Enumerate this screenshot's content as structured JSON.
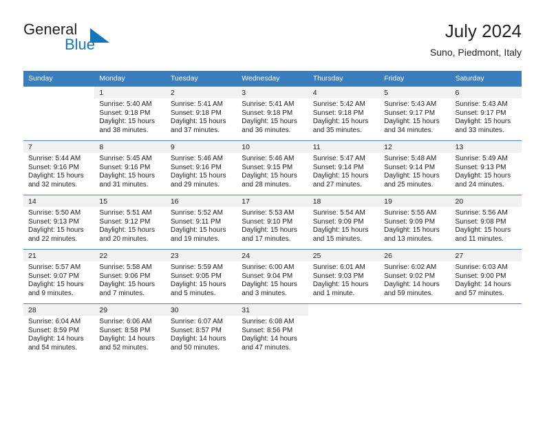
{
  "brand": {
    "name_part1": "General",
    "name_part2": "Blue",
    "triangle_color": "#1175c0"
  },
  "header": {
    "title": "July 2024",
    "subtitle": "Suno, Piedmont, Italy"
  },
  "theme": {
    "header_bg": "#3a7ebf",
    "daynum_band_bg": "#f1f1f1",
    "row_border": "#4a86c5",
    "text": "#1a1a1a"
  },
  "weekdays": [
    "Sunday",
    "Monday",
    "Tuesday",
    "Wednesday",
    "Thursday",
    "Friday",
    "Saturday"
  ],
  "weeks": [
    [
      {
        "day": "",
        "sunrise": "",
        "sunset": "",
        "daylight1": "",
        "daylight2": "",
        "blank": true
      },
      {
        "day": "1",
        "sunrise": "Sunrise: 5:40 AM",
        "sunset": "Sunset: 9:18 PM",
        "daylight1": "Daylight: 15 hours",
        "daylight2": "and 38 minutes."
      },
      {
        "day": "2",
        "sunrise": "Sunrise: 5:41 AM",
        "sunset": "Sunset: 9:18 PM",
        "daylight1": "Daylight: 15 hours",
        "daylight2": "and 37 minutes."
      },
      {
        "day": "3",
        "sunrise": "Sunrise: 5:41 AM",
        "sunset": "Sunset: 9:18 PM",
        "daylight1": "Daylight: 15 hours",
        "daylight2": "and 36 minutes."
      },
      {
        "day": "4",
        "sunrise": "Sunrise: 5:42 AM",
        "sunset": "Sunset: 9:18 PM",
        "daylight1": "Daylight: 15 hours",
        "daylight2": "and 35 minutes."
      },
      {
        "day": "5",
        "sunrise": "Sunrise: 5:43 AM",
        "sunset": "Sunset: 9:17 PM",
        "daylight1": "Daylight: 15 hours",
        "daylight2": "and 34 minutes."
      },
      {
        "day": "6",
        "sunrise": "Sunrise: 5:43 AM",
        "sunset": "Sunset: 9:17 PM",
        "daylight1": "Daylight: 15 hours",
        "daylight2": "and 33 minutes."
      }
    ],
    [
      {
        "day": "7",
        "sunrise": "Sunrise: 5:44 AM",
        "sunset": "Sunset: 9:16 PM",
        "daylight1": "Daylight: 15 hours",
        "daylight2": "and 32 minutes."
      },
      {
        "day": "8",
        "sunrise": "Sunrise: 5:45 AM",
        "sunset": "Sunset: 9:16 PM",
        "daylight1": "Daylight: 15 hours",
        "daylight2": "and 31 minutes."
      },
      {
        "day": "9",
        "sunrise": "Sunrise: 5:46 AM",
        "sunset": "Sunset: 9:16 PM",
        "daylight1": "Daylight: 15 hours",
        "daylight2": "and 29 minutes."
      },
      {
        "day": "10",
        "sunrise": "Sunrise: 5:46 AM",
        "sunset": "Sunset: 9:15 PM",
        "daylight1": "Daylight: 15 hours",
        "daylight2": "and 28 minutes."
      },
      {
        "day": "11",
        "sunrise": "Sunrise: 5:47 AM",
        "sunset": "Sunset: 9:14 PM",
        "daylight1": "Daylight: 15 hours",
        "daylight2": "and 27 minutes."
      },
      {
        "day": "12",
        "sunrise": "Sunrise: 5:48 AM",
        "sunset": "Sunset: 9:14 PM",
        "daylight1": "Daylight: 15 hours",
        "daylight2": "and 25 minutes."
      },
      {
        "day": "13",
        "sunrise": "Sunrise: 5:49 AM",
        "sunset": "Sunset: 9:13 PM",
        "daylight1": "Daylight: 15 hours",
        "daylight2": "and 24 minutes."
      }
    ],
    [
      {
        "day": "14",
        "sunrise": "Sunrise: 5:50 AM",
        "sunset": "Sunset: 9:13 PM",
        "daylight1": "Daylight: 15 hours",
        "daylight2": "and 22 minutes."
      },
      {
        "day": "15",
        "sunrise": "Sunrise: 5:51 AM",
        "sunset": "Sunset: 9:12 PM",
        "daylight1": "Daylight: 15 hours",
        "daylight2": "and 20 minutes."
      },
      {
        "day": "16",
        "sunrise": "Sunrise: 5:52 AM",
        "sunset": "Sunset: 9:11 PM",
        "daylight1": "Daylight: 15 hours",
        "daylight2": "and 19 minutes."
      },
      {
        "day": "17",
        "sunrise": "Sunrise: 5:53 AM",
        "sunset": "Sunset: 9:10 PM",
        "daylight1": "Daylight: 15 hours",
        "daylight2": "and 17 minutes."
      },
      {
        "day": "18",
        "sunrise": "Sunrise: 5:54 AM",
        "sunset": "Sunset: 9:09 PM",
        "daylight1": "Daylight: 15 hours",
        "daylight2": "and 15 minutes."
      },
      {
        "day": "19",
        "sunrise": "Sunrise: 5:55 AM",
        "sunset": "Sunset: 9:09 PM",
        "daylight1": "Daylight: 15 hours",
        "daylight2": "and 13 minutes."
      },
      {
        "day": "20",
        "sunrise": "Sunrise: 5:56 AM",
        "sunset": "Sunset: 9:08 PM",
        "daylight1": "Daylight: 15 hours",
        "daylight2": "and 11 minutes."
      }
    ],
    [
      {
        "day": "21",
        "sunrise": "Sunrise: 5:57 AM",
        "sunset": "Sunset: 9:07 PM",
        "daylight1": "Daylight: 15 hours",
        "daylight2": "and 9 minutes."
      },
      {
        "day": "22",
        "sunrise": "Sunrise: 5:58 AM",
        "sunset": "Sunset: 9:06 PM",
        "daylight1": "Daylight: 15 hours",
        "daylight2": "and 7 minutes."
      },
      {
        "day": "23",
        "sunrise": "Sunrise: 5:59 AM",
        "sunset": "Sunset: 9:05 PM",
        "daylight1": "Daylight: 15 hours",
        "daylight2": "and 5 minutes."
      },
      {
        "day": "24",
        "sunrise": "Sunrise: 6:00 AM",
        "sunset": "Sunset: 9:04 PM",
        "daylight1": "Daylight: 15 hours",
        "daylight2": "and 3 minutes."
      },
      {
        "day": "25",
        "sunrise": "Sunrise: 6:01 AM",
        "sunset": "Sunset: 9:03 PM",
        "daylight1": "Daylight: 15 hours",
        "daylight2": "and 1 minute."
      },
      {
        "day": "26",
        "sunrise": "Sunrise: 6:02 AM",
        "sunset": "Sunset: 9:02 PM",
        "daylight1": "Daylight: 14 hours",
        "daylight2": "and 59 minutes."
      },
      {
        "day": "27",
        "sunrise": "Sunrise: 6:03 AM",
        "sunset": "Sunset: 9:00 PM",
        "daylight1": "Daylight: 14 hours",
        "daylight2": "and 57 minutes."
      }
    ],
    [
      {
        "day": "28",
        "sunrise": "Sunrise: 6:04 AM",
        "sunset": "Sunset: 8:59 PM",
        "daylight1": "Daylight: 14 hours",
        "daylight2": "and 54 minutes."
      },
      {
        "day": "29",
        "sunrise": "Sunrise: 6:06 AM",
        "sunset": "Sunset: 8:58 PM",
        "daylight1": "Daylight: 14 hours",
        "daylight2": "and 52 minutes."
      },
      {
        "day": "30",
        "sunrise": "Sunrise: 6:07 AM",
        "sunset": "Sunset: 8:57 PM",
        "daylight1": "Daylight: 14 hours",
        "daylight2": "and 50 minutes."
      },
      {
        "day": "31",
        "sunrise": "Sunrise: 6:08 AM",
        "sunset": "Sunset: 8:56 PM",
        "daylight1": "Daylight: 14 hours",
        "daylight2": "and 47 minutes."
      },
      {
        "day": "",
        "sunrise": "",
        "sunset": "",
        "daylight1": "",
        "daylight2": "",
        "blank": true
      },
      {
        "day": "",
        "sunrise": "",
        "sunset": "",
        "daylight1": "",
        "daylight2": "",
        "blank": true
      },
      {
        "day": "",
        "sunrise": "",
        "sunset": "",
        "daylight1": "",
        "daylight2": "",
        "blank": true
      }
    ]
  ]
}
